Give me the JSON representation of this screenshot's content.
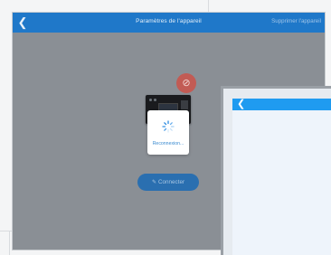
{
  "header": {
    "back_icon": "chevron-left-icon",
    "title": "Paramètres de l'appareil",
    "action_label": "Supprimer l'appareil"
  },
  "device": {
    "image": "router-device",
    "status_icon": "bluetooth-off-icon",
    "status_color": "#c25b54"
  },
  "loading": {
    "spinner_icon": "spinner-icon",
    "label": "Reconnexion..."
  },
  "connect_button": {
    "icon": "pencil-icon",
    "label": "Connecter"
  },
  "second_screen": {
    "back_icon": "chevron-left-icon",
    "accent": "#1f9bf0"
  },
  "colors": {
    "topbar": "#1f78c9",
    "overlay": "#8a8f95",
    "button": "#2a6fb0"
  }
}
